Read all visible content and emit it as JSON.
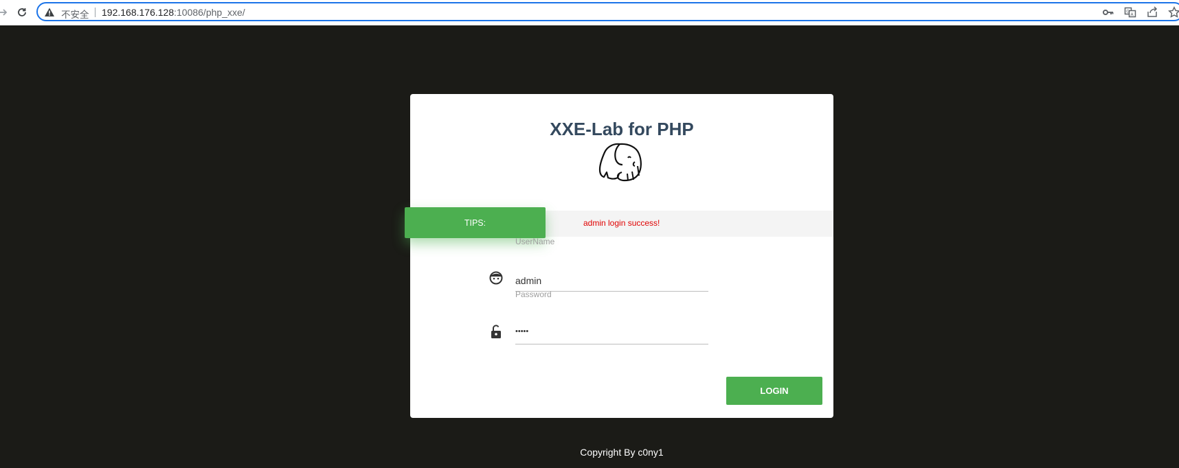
{
  "browser": {
    "insecure_label": "不安全",
    "url_host": "192.168.176.128",
    "url_rest": ":10086/php_xxe/"
  },
  "card": {
    "title": "XXE-Lab for PHP",
    "tips_label": "TIPS:",
    "tips_message": "admin login success!",
    "username_label": "UserName",
    "username_value": "admin",
    "password_label": "Password",
    "password_value": "•••••",
    "login_label": "LOGIN"
  },
  "footer": {
    "copyright": "Copyright By c0ny1"
  },
  "colors": {
    "page_bg": "#1b1b17",
    "accent_green": "#4caf50",
    "title": "#34495e",
    "tips_message": "#e00000",
    "omnibox_border": "#1a73e8"
  },
  "icons": [
    "forward-icon",
    "reload-icon",
    "warning-icon",
    "key-icon",
    "translate-icon",
    "share-icon",
    "star-icon",
    "elephant-logo-icon",
    "user-face-icon",
    "lock-open-icon"
  ]
}
